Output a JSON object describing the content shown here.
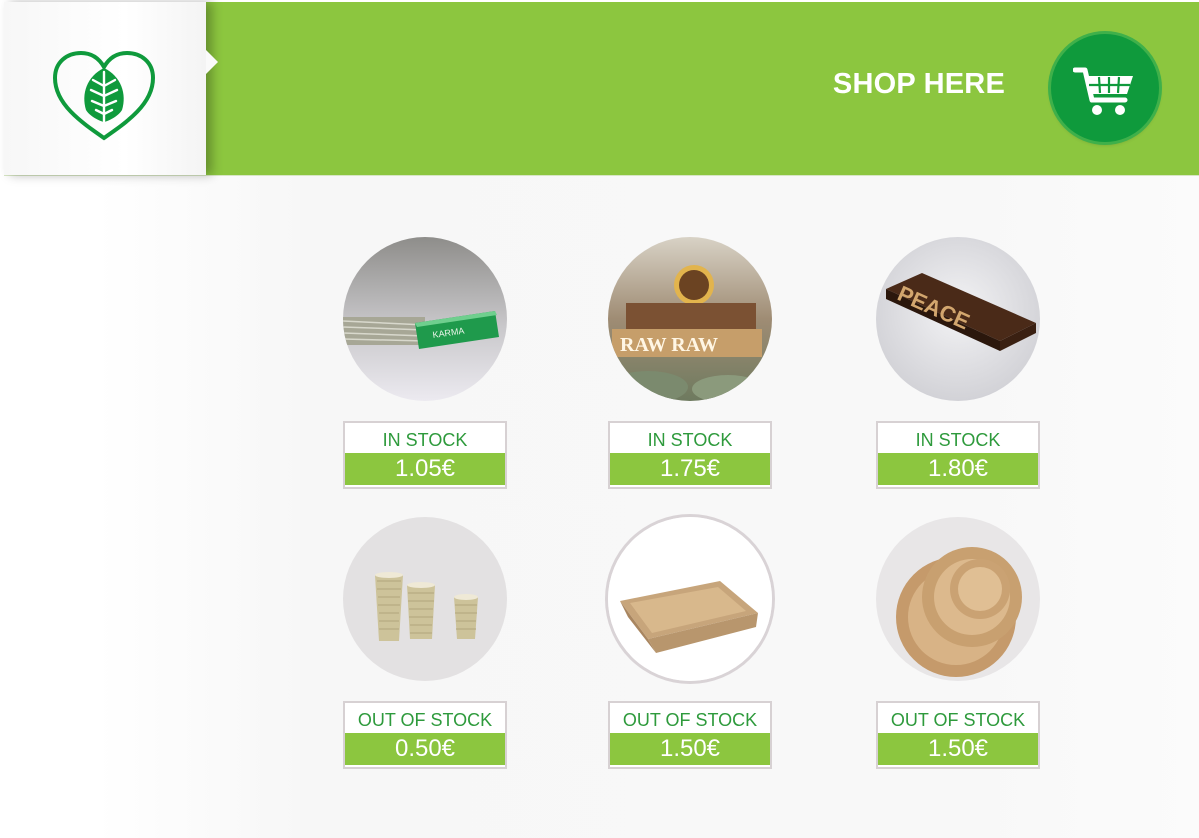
{
  "header": {
    "shop_label": "SHOP HERE",
    "logo_icon": "heart-leaf-icon",
    "cart_icon": "shopping-cart-icon",
    "colors": {
      "brand_green": "#8cc63f",
      "cart_green": "#0f9a3c",
      "text_green": "#2e9a3c"
    }
  },
  "products": [
    {
      "name": "KARMA",
      "image": "karma-filter-tips-image",
      "status": "IN STOCK",
      "price": "1.05€"
    },
    {
      "name": "RAW",
      "image": "raw-rolling-papers-image",
      "status": "IN STOCK",
      "price": "1.75€"
    },
    {
      "name": "PEACE",
      "image": "peace-rolling-papers-image",
      "status": "IN STOCK",
      "price": "1.80€"
    },
    {
      "name": "Paper cups",
      "image": "paper-cups-image",
      "status": "OUT OF STOCK",
      "price": "0.50€"
    },
    {
      "name": "Paper food tray",
      "image": "paper-tray-image",
      "status": "OUT OF STOCK",
      "price": "1.50€"
    },
    {
      "name": "Bamboo plates",
      "image": "bamboo-plates-image",
      "status": "OUT OF STOCK",
      "price": "1.50€"
    }
  ]
}
